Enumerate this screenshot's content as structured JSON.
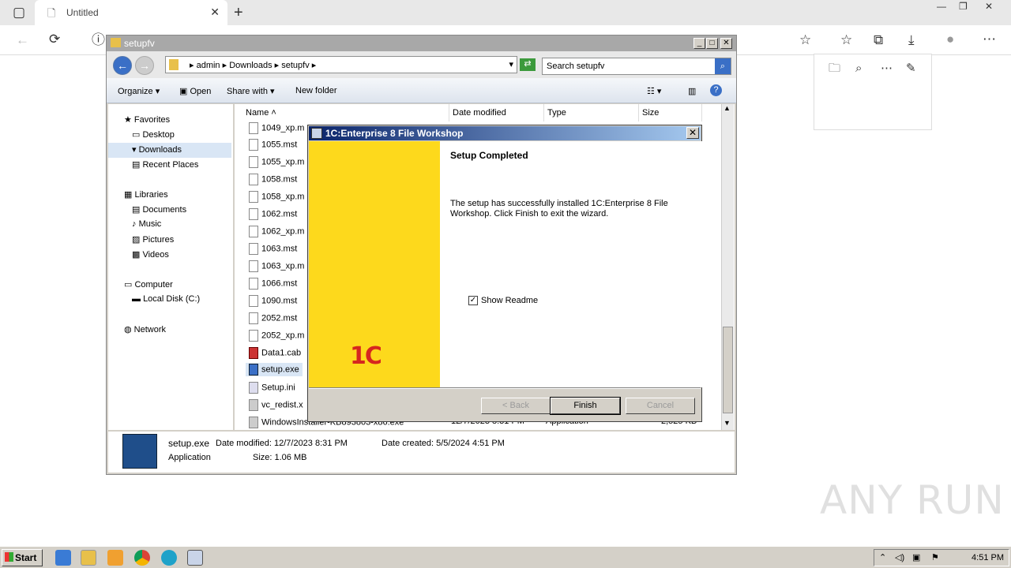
{
  "browser": {
    "tab_title": "Untitled",
    "tab_close": "✕",
    "new_tab": "+",
    "back": "←",
    "refresh": "⟳",
    "info": "ⓘ",
    "win_controls": [
      "—",
      "❐",
      "✕"
    ]
  },
  "explorer": {
    "title": "setupfv",
    "breadcrumb": [
      "admin",
      "Downloads",
      "setupfv"
    ],
    "search_placeholder": "Search setupfv",
    "commands": {
      "organize": "Organize",
      "open": "Open",
      "share": "Share with",
      "new_folder": "New folder"
    },
    "nav": {
      "favorites": "Favorites",
      "desktop": "Desktop",
      "downloads": "Downloads",
      "recent": "Recent Places",
      "libraries": "Libraries",
      "documents": "Documents",
      "music": "Music",
      "pictures": "Pictures",
      "videos": "Videos",
      "computer": "Computer",
      "local_disk": "Local Disk (C:)",
      "network": "Network"
    },
    "columns": {
      "name": "Name",
      "date": "Date modified",
      "type": "Type",
      "size": "Size"
    },
    "files": [
      "1049_xp.m",
      "1055.mst",
      "1055_xp.m",
      "1058.mst",
      "1058_xp.m",
      "1062.mst",
      "1062_xp.m",
      "1063.mst",
      "1063_xp.m",
      "1066.mst",
      "1090.mst",
      "2052.mst",
      "2052_xp.m",
      "Data1.cab",
      "setup.exe",
      "Setup.ini",
      "vc_redist.x",
      "WindowsInstaller-KB893803-x86.exe"
    ],
    "last_row": {
      "date": "12/7/2023 8:31 PM",
      "type": "Application",
      "size": "2,525 KB"
    },
    "details": {
      "name": "setup.exe",
      "modified": "Date modified: 12/7/2023 8:31 PM",
      "created": "Date created: 5/5/2024 4:51 PM",
      "kind": "Application",
      "size": "Size: 1.06 MB"
    }
  },
  "dialog": {
    "title": "1C:Enterprise 8 File Workshop",
    "heading": "Setup Completed",
    "body": "The setup has successfully installed 1C:Enterprise 8 File Workshop. Click Finish to exit the wizard.",
    "checkbox_label": "Show Readme",
    "checkbox_checked": "✓",
    "logo": "1C",
    "buttons": {
      "back": "< Back",
      "finish": "Finish",
      "cancel": "Cancel"
    }
  },
  "taskbar": {
    "start": "Start",
    "clock": "4:51 PM"
  },
  "watermark": "ANY RUN",
  "colors": {
    "accent": "#0a246a",
    "yellow": "#fdd91c",
    "logo_red": "#d6261f"
  }
}
